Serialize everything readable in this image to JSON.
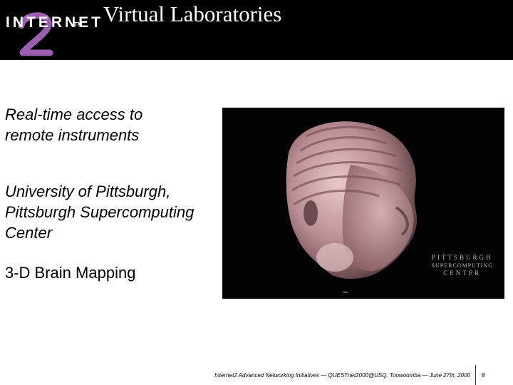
{
  "header": {
    "logo_text": "INTERNET",
    "logo_tm": "TM",
    "logo_numeral": "2",
    "title": "Virtual Laboratories"
  },
  "bullets": [
    {
      "text": "Real-time access to\nremote instruments",
      "italic": true
    },
    {
      "text": "University of Pittsburgh,\nPittsburgh Supercomputing\nCenter",
      "italic": true
    },
    {
      "text": "3-D Brain Mapping",
      "italic": false
    }
  ],
  "image": {
    "overlay_line1": "PITTSBURGH",
    "overlay_line2": "SUPERCOMPUTING",
    "overlay_line3": "CENTER"
  },
  "footer": {
    "text": "Internet2 Advanced Networking Initiatives — QUESTnet2000@USQ, Toowoomba — June 27th, 2000",
    "page_number": "8",
    "accent_color": "#c00000"
  }
}
